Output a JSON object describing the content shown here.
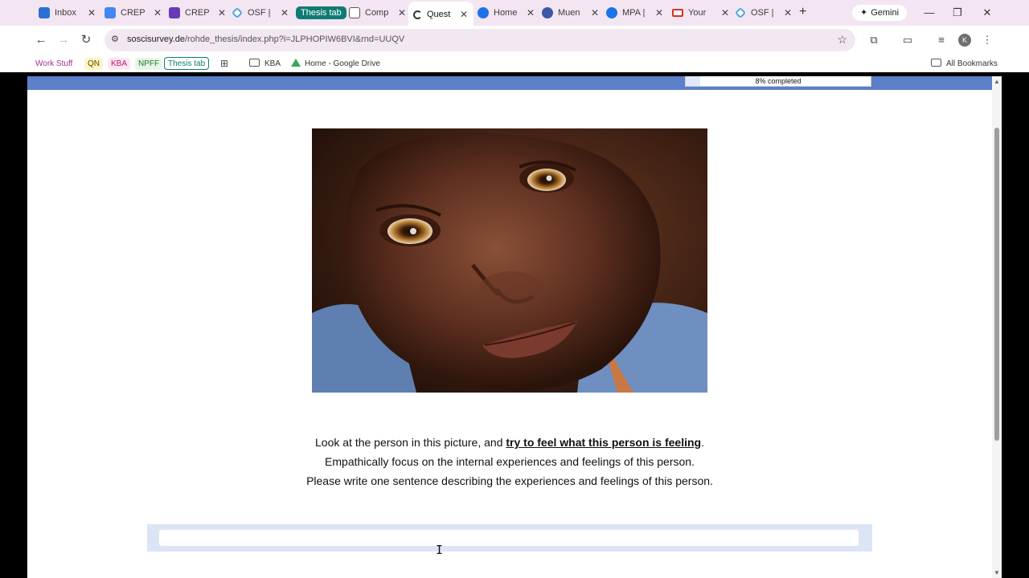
{
  "browser": {
    "tabs": [
      {
        "label": "Inbox",
        "icon": "outlook-icon",
        "color": "#2b6fd6"
      },
      {
        "label": "CREP",
        "icon": "docs-icon",
        "color": "#4285f4"
      },
      {
        "label": "CREP",
        "icon": "forms-icon",
        "color": "#673ab7"
      },
      {
        "label": "OSF |",
        "icon": "osf-icon",
        "color": "#50a7d8"
      },
      {
        "label": "Comp",
        "icon": "spreadsheet-icon",
        "color": "#555555"
      },
      {
        "label": "Quest",
        "icon": "soscisurvey-icon",
        "color": "#333333",
        "active": true
      },
      {
        "label": "Home",
        "icon": "home-icon",
        "color": "#1a73e8"
      },
      {
        "label": "Muen",
        "icon": "mensa-icon",
        "color": "#3a57a8"
      },
      {
        "label": "MPA |",
        "icon": "mpa-icon",
        "color": "#1a73e8"
      },
      {
        "label": "Your",
        "icon": "gmail-icon",
        "color": "#d93025"
      },
      {
        "label": "OSF |",
        "icon": "osf-icon",
        "color": "#50a7d8"
      }
    ],
    "tab_group_label": "Thesis tab",
    "gemini_label": "Gemini",
    "url_host": "soscisurvey.de",
    "url_path": "/rohde_thesis/index.php?i=JLPHOPIW6BVI&rnd=UUQV",
    "profile_initial": "K",
    "bookmarks": {
      "work": "Work Stuff",
      "qn": "QN",
      "kba": "KBA",
      "npff": "NPFF",
      "thesis": "Thesis tab",
      "kba_folder": "KBA",
      "drive": "Home - Google Drive",
      "all": "All Bookmarks"
    }
  },
  "survey": {
    "progress_text": "8% completed",
    "progress_fraction": 0.08,
    "line1_pre": "Look at the person in this picture, and ",
    "line1_emphasis": "try to feel what this person is feeling",
    "line1_post": ".",
    "line2": "Empathically focus on the internal experiences and feelings of this person.",
    "line3": "Please write one sentence describing the experiences and feelings of this person.",
    "answer_value": "",
    "image_alt_icon": "portrait-photo"
  },
  "colors": {
    "progress_band": "#5b7fc8",
    "answer_panel": "#dce5f5",
    "tab_group": "#0f7b73"
  }
}
